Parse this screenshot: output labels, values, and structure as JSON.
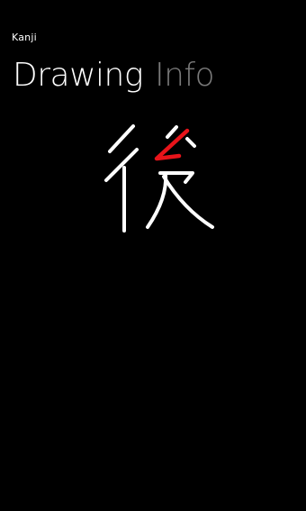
{
  "app": {
    "title": "Kanji"
  },
  "pivot": {
    "items": [
      {
        "label": "Drawing",
        "active": true
      },
      {
        "label": "Info",
        "active": false
      }
    ]
  },
  "drawing": {
    "kanji": "後",
    "highlight_stroke_color": "#e8141a",
    "stroke_color": "#ffffff"
  }
}
